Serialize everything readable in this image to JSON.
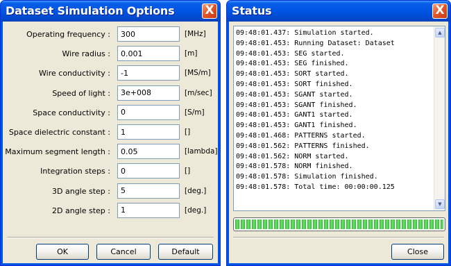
{
  "options_window": {
    "title": "Dataset Simulation Options",
    "close_glyph": "X",
    "fields": [
      {
        "label": "Operating frequency :",
        "value": "300",
        "unit": "[MHz]"
      },
      {
        "label": "Wire radius :",
        "value": "0.001",
        "unit": "[m]"
      },
      {
        "label": "Wire conductivity :",
        "value": "-1",
        "unit": "[MS/m]"
      },
      {
        "label": "Speed of light :",
        "value": "3e+008",
        "unit": "[m/sec]"
      },
      {
        "label": "Space conductivity :",
        "value": "0",
        "unit": "[S/m]"
      },
      {
        "label": "Space dielectric constant :",
        "value": "1",
        "unit": "[]"
      },
      {
        "label": "Maximum segment length :",
        "value": "0.05",
        "unit": "[lambda]"
      },
      {
        "label": "Integration steps :",
        "value": "0",
        "unit": "[]"
      },
      {
        "label": "3D angle step :",
        "value": "5",
        "unit": "[deg.]"
      },
      {
        "label": "2D angle step :",
        "value": "1",
        "unit": "[deg.]"
      }
    ],
    "buttons": {
      "ok": "OK",
      "cancel": "Cancel",
      "default": "Default"
    }
  },
  "status_window": {
    "title": "Status",
    "close_glyph": "X",
    "log": [
      "09:48:01.437: Simulation started.",
      "09:48:01.453: Running Dataset: Dataset",
      "09:48:01.453: SEG started.",
      "09:48:01.453: SEG finished.",
      "09:48:01.453: SORT started.",
      "09:48:01.453: SORT finished.",
      "09:48:01.453: SGANT started.",
      "09:48:01.453: SGANT finished.",
      "09:48:01.453: GANT1 started.",
      "09:48:01.453: GANT1 finished.",
      "09:48:01.468: PATTERNS started.",
      "09:48:01.562: PATTERNS finished.",
      "09:48:01.562: NORM started.",
      "09:48:01.578: NORM finished.",
      "09:48:01.578: Simulation finished.",
      "09:48:01.578: Total time: 00:00:00.125"
    ],
    "progress_percent": 100,
    "close_button": "Close"
  },
  "colors": {
    "title_bar": "#0054e3",
    "client_bg": "#ece9d8",
    "close_button": "#e2572a",
    "progress": "#2fbb2f"
  },
  "icons": {
    "scroll_up": "triangle-up-icon",
    "scroll_down": "triangle-down-icon"
  }
}
